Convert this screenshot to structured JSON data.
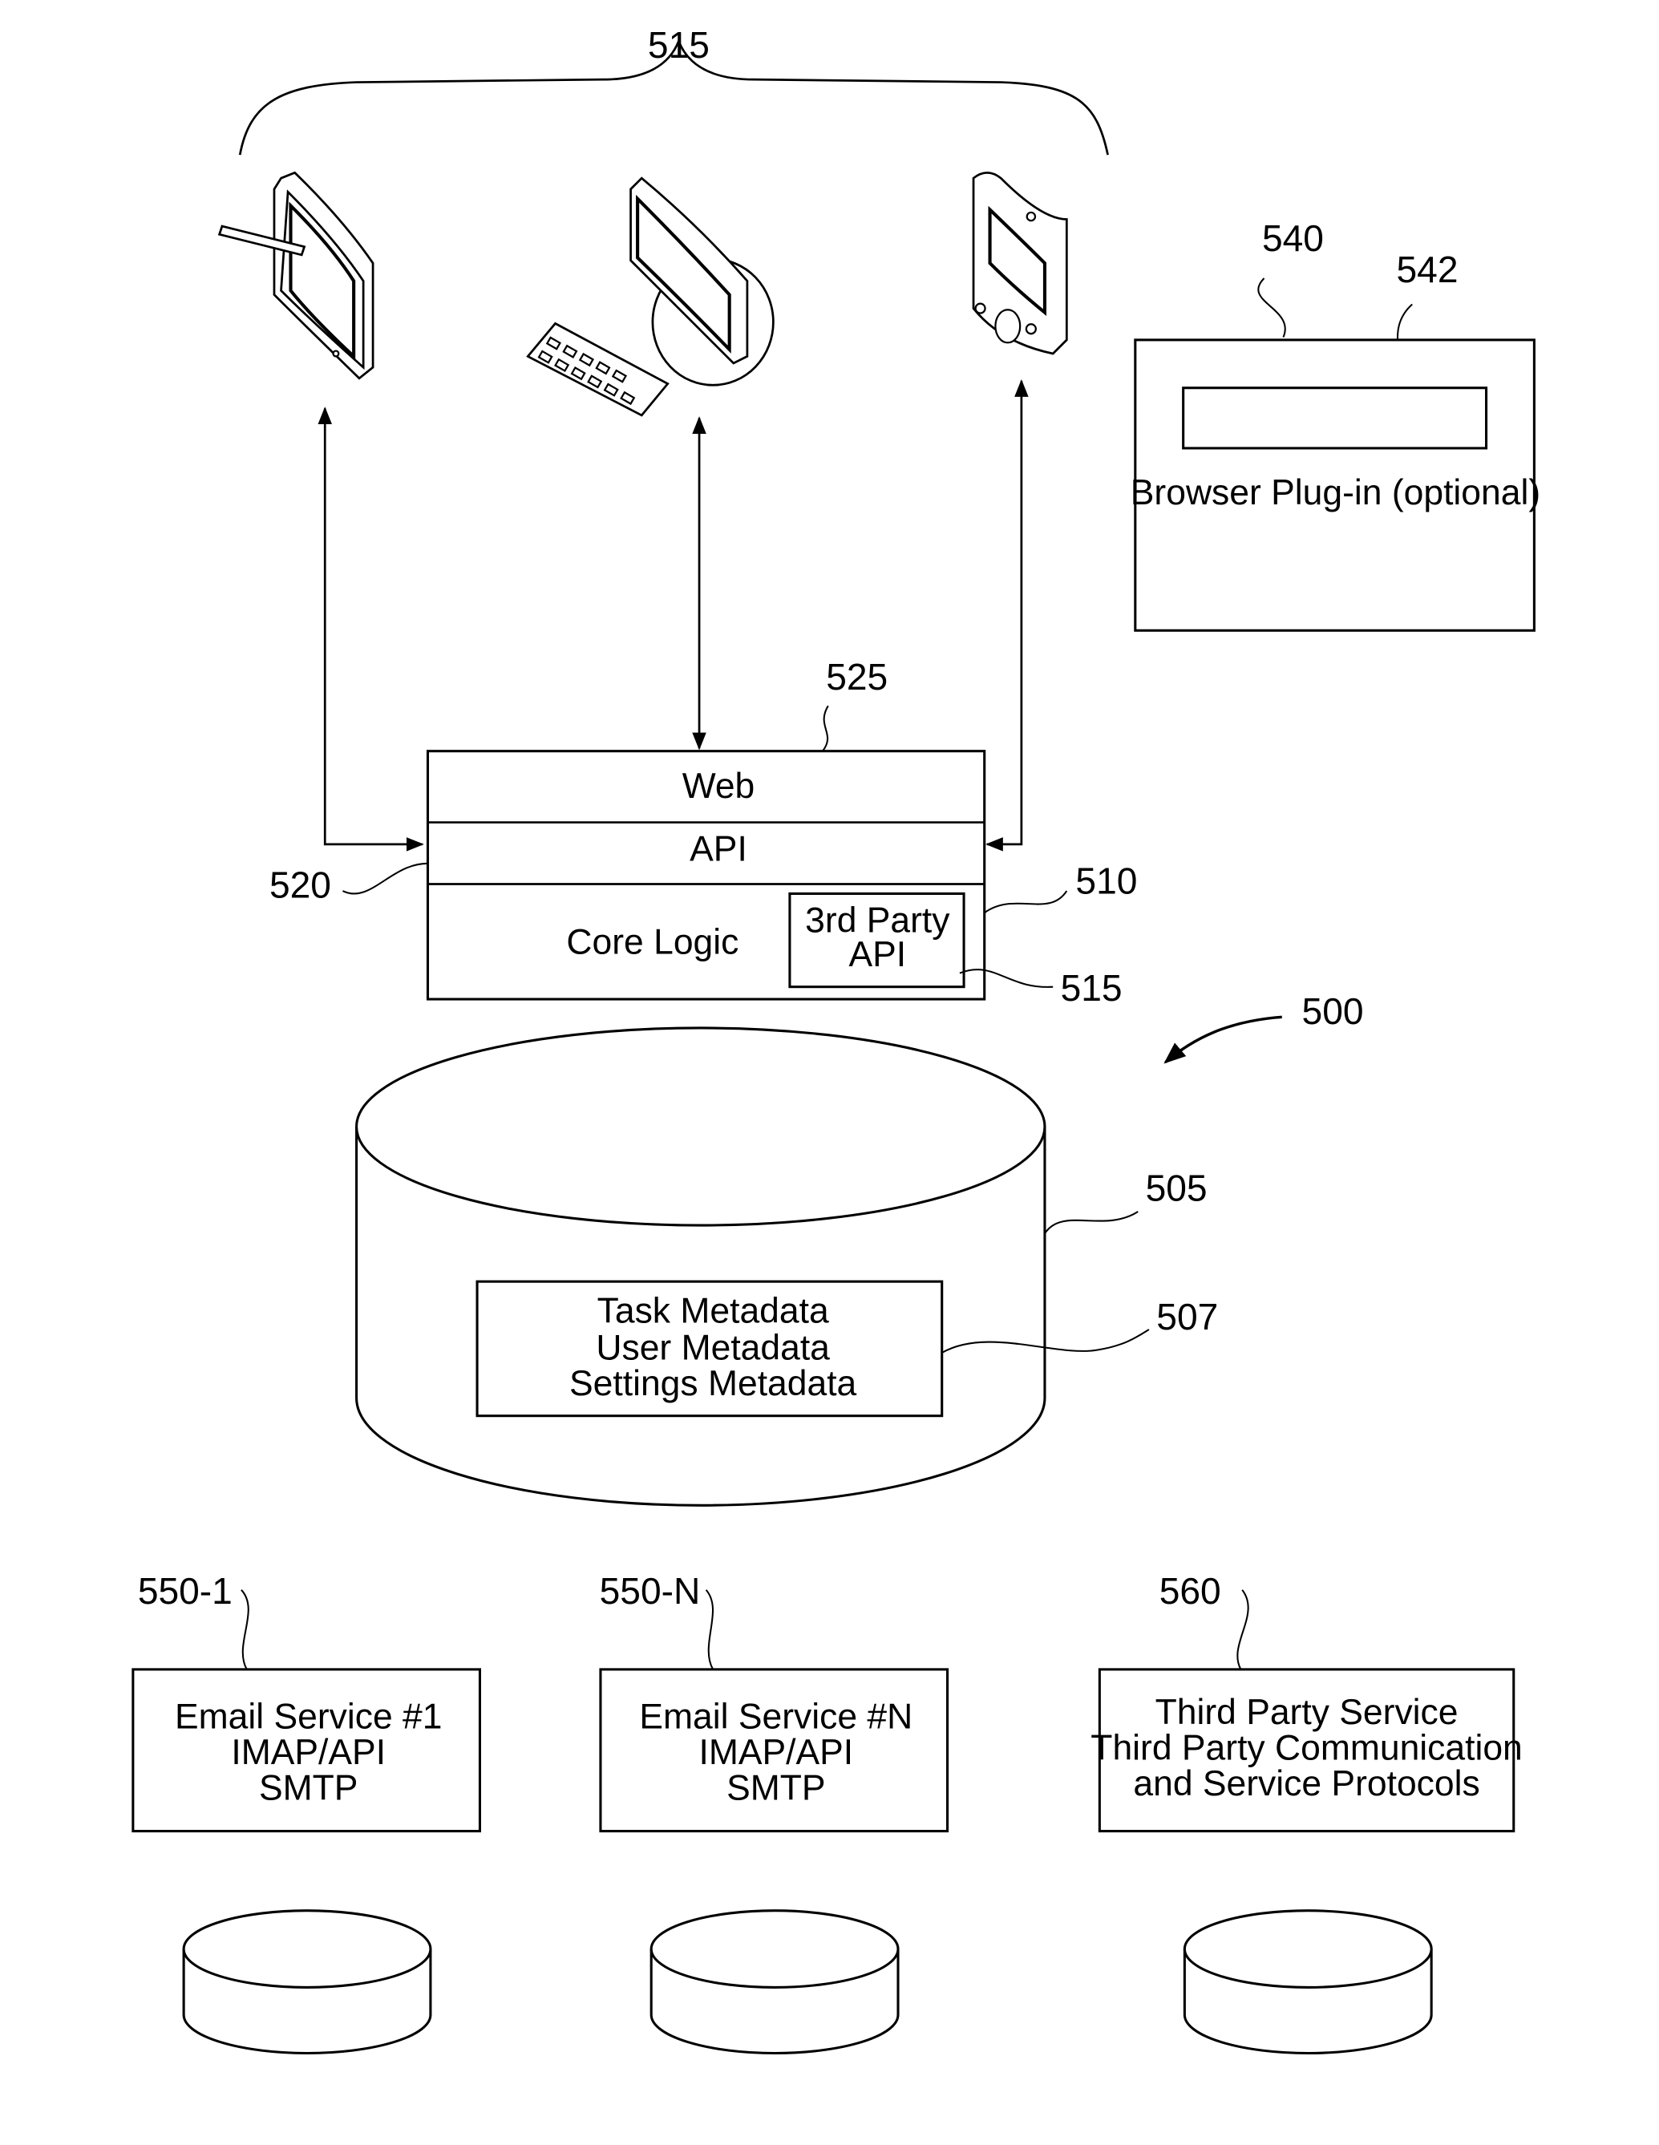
{
  "figure": {
    "system_ref": "500",
    "client_devices": {
      "ref": "515",
      "items": [
        {
          "name": "tablet-with-stylus"
        },
        {
          "name": "desktop-computer-with-keyboard"
        },
        {
          "name": "handheld-pda"
        }
      ]
    },
    "browser_plugin": {
      "ref": "540",
      "inner_ref": "542",
      "label": "Browser Plug-in (optional)"
    },
    "server": {
      "ref": "510",
      "web_ref": "525",
      "api_ref": "520",
      "layers": {
        "web": "Web",
        "api": "API",
        "core": "Core Logic"
      },
      "third_party_api": {
        "ref": "515",
        "line1": "3rd Party",
        "line2": "API"
      }
    },
    "database": {
      "ref": "505",
      "metadata_ref": "507",
      "lines": [
        "Task Metadata",
        "User Metadata",
        "Settings Metadata"
      ]
    },
    "services": [
      {
        "ref": "550-1",
        "lines": [
          "Email Service #1",
          "IMAP/API",
          "SMTP"
        ]
      },
      {
        "ref": "550-N",
        "lines": [
          "Email Service #N",
          "IMAP/API",
          "SMTP"
        ]
      },
      {
        "ref": "560",
        "lines": [
          "Third Party Service",
          "Third Party Communication",
          "and Service Protocols"
        ]
      }
    ]
  }
}
